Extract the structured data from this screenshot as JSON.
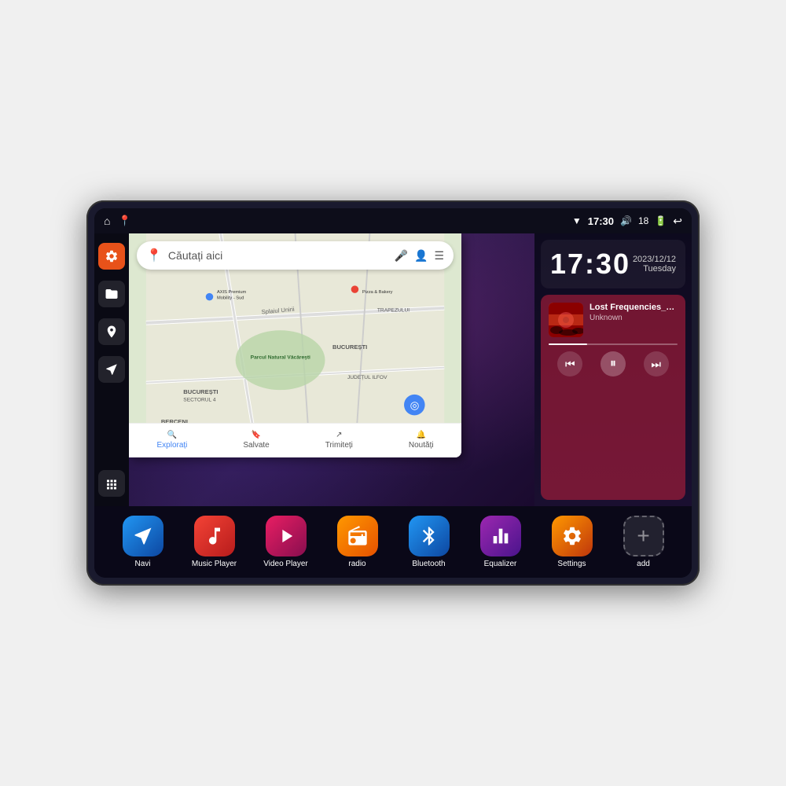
{
  "device": {
    "statusBar": {
      "leftIcons": [
        "home-icon",
        "map-pin-icon"
      ],
      "rightIcons": [
        "wifi-icon",
        "time",
        "speaker-icon",
        "battery-icon",
        "back-icon"
      ],
      "time": "17:30",
      "batteryLevel": "18"
    },
    "clock": {
      "time": "17:30",
      "date": "2023/12/12",
      "day": "Tuesday"
    },
    "music": {
      "title": "Lost Frequencies_Janie...",
      "artist": "Unknown",
      "albumArtColor": "#c0392b"
    },
    "map": {
      "searchPlaceholder": "Căutați aici",
      "locations": [
        "AXIS Premium Mobility - Sud",
        "Pizza & Bakery",
        "Parcul Natural Văcărești",
        "BUCUREȘTI SECTORUL 4",
        "BUCUREȘTI",
        "JUDEȚUL ILFOV",
        "BERCENI",
        "TRAPEZULUI"
      ],
      "bottomItems": [
        {
          "label": "Explorați",
          "active": true
        },
        {
          "label": "Salvate",
          "active": false
        },
        {
          "label": "Trimiteți",
          "active": false
        },
        {
          "label": "Noutăți",
          "active": false
        }
      ]
    },
    "sidebarIcons": [
      {
        "name": "settings-icon",
        "type": "orange"
      },
      {
        "name": "folder-icon",
        "type": "dark"
      },
      {
        "name": "map-icon",
        "type": "dark"
      },
      {
        "name": "navigation-icon",
        "type": "dark"
      }
    ],
    "apps": [
      {
        "name": "Navi",
        "iconClass": "icon-navi",
        "icon": "▲"
      },
      {
        "name": "Music Player",
        "iconClass": "icon-music",
        "icon": "♪"
      },
      {
        "name": "Video Player",
        "iconClass": "icon-video",
        "icon": "▶"
      },
      {
        "name": "radio",
        "iconClass": "icon-radio",
        "icon": "📻"
      },
      {
        "name": "Bluetooth",
        "iconClass": "icon-bluetooth",
        "icon": "⚡"
      },
      {
        "name": "Equalizer",
        "iconClass": "icon-eq",
        "icon": "⎍"
      },
      {
        "name": "Settings",
        "iconClass": "icon-settings",
        "icon": "⚙"
      },
      {
        "name": "add",
        "iconClass": "icon-add",
        "icon": "+"
      }
    ]
  }
}
